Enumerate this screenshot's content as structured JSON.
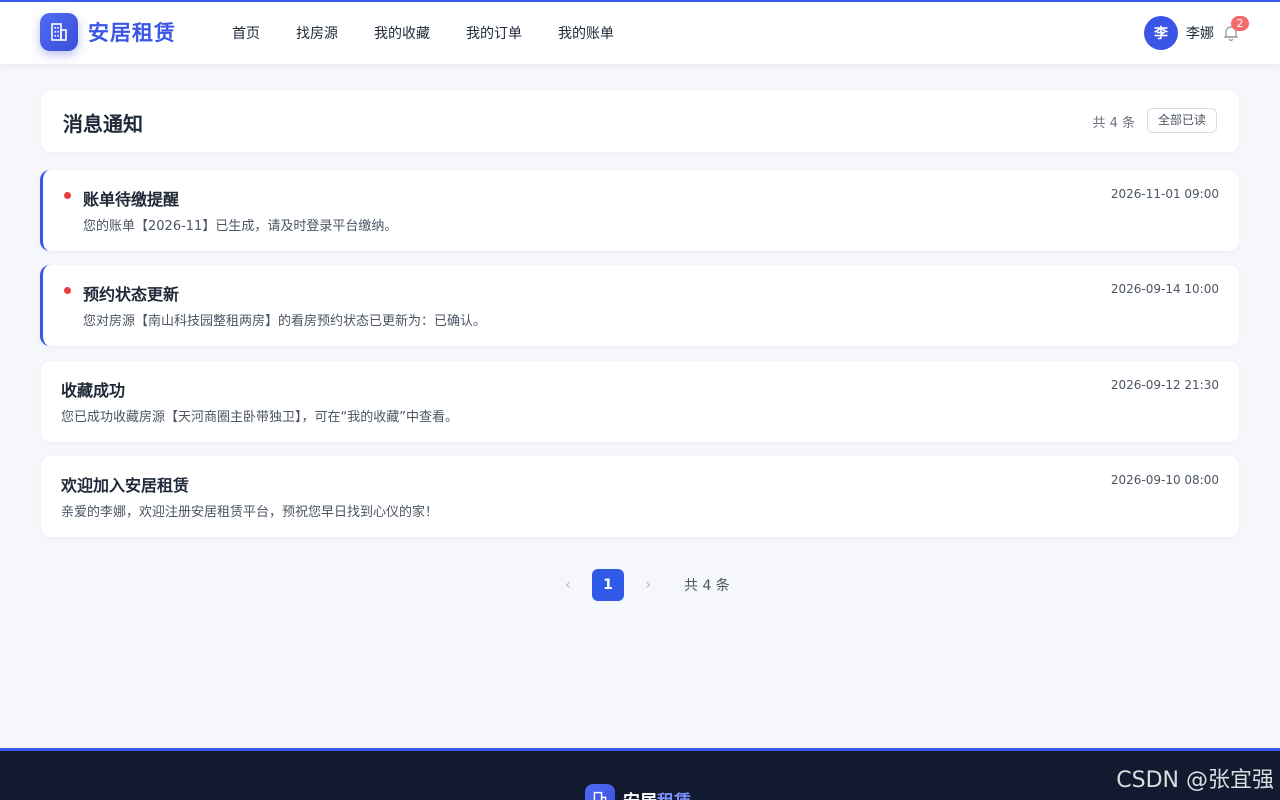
{
  "header": {
    "brand_name": "安居租赁",
    "nav": [
      "首页",
      "找房源",
      "我的收藏",
      "我的订单",
      "我的账单"
    ],
    "user": {
      "avatar_initial": "李",
      "name": "李娜",
      "notification_count": "2"
    }
  },
  "page": {
    "title": "消息通知",
    "total_label": "共 4 条",
    "mark_all_label": "全部已读"
  },
  "messages": [
    {
      "title": "账单待缴提醒",
      "body": "您的账单【2026-11】已生成，请及时登录平台缴纳。",
      "time": "2026-11-01 09:00",
      "unread": true
    },
    {
      "title": "预约状态更新",
      "body": "您对房源【南山科技园整租两房】的看房预约状态已更新为：已确认。",
      "time": "2026-09-14 10:00",
      "unread": true
    },
    {
      "title": "收藏成功",
      "body": "您已成功收藏房源【天河商圈主卧带独卫】，可在“我的收藏”中查看。",
      "time": "2026-09-12 21:30",
      "unread": false
    },
    {
      "title": "欢迎加入安居租赁",
      "body": "亲爱的李娜，欢迎注册安居租赁平台，预祝您早日找到心仪的家！",
      "time": "2026-09-10 08:00",
      "unread": false
    }
  ],
  "pagination": {
    "prev": "‹",
    "current": "1",
    "next": "›",
    "total": "共 4 条"
  },
  "footer": {
    "brand_part1": "安居",
    "brand_part2": "租赁"
  },
  "watermark": "CSDN @张宜强",
  "colors": {
    "accent": "#3b56e6",
    "unread_dot": "#e53e3e",
    "badge": "#f56c6c",
    "footer_bg": "#111a2e"
  }
}
